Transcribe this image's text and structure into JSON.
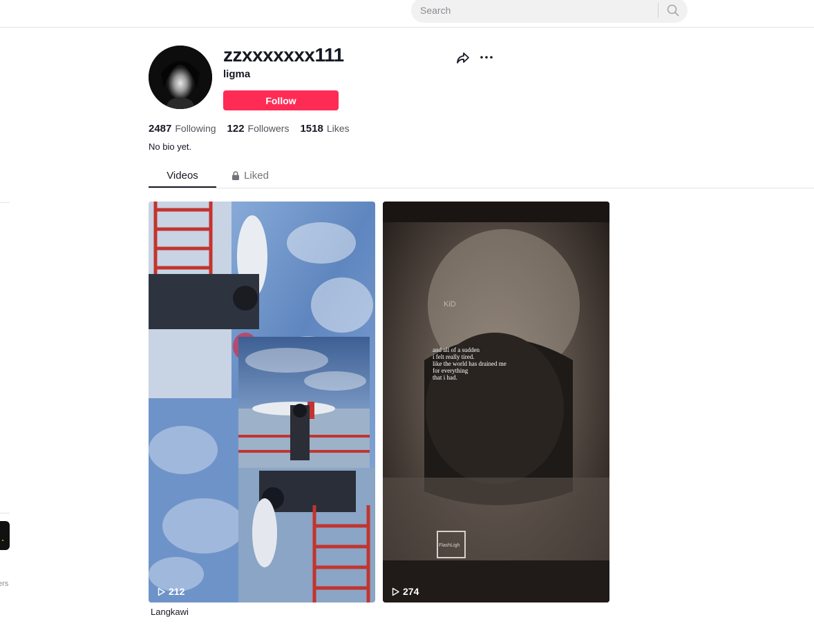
{
  "search": {
    "placeholder": "Search"
  },
  "profile": {
    "username": "zzxxxxxxx111",
    "nickname": "ligma",
    "follow_label": "Follow",
    "bio": "No bio yet."
  },
  "stats": [
    {
      "value": "2487",
      "label": "Following"
    },
    {
      "value": "122",
      "label": "Followers"
    },
    {
      "value": "1518",
      "label": "Likes"
    }
  ],
  "tabs": {
    "videos": "Videos",
    "liked": "Liked"
  },
  "videos": [
    {
      "views": "212",
      "caption": "Langkawi"
    },
    {
      "views": "274",
      "caption": "",
      "overlay_text": [
        "and all of a sudden",
        "i felt really tired.",
        "like the world has drained me",
        "for everything",
        "that i had."
      ],
      "kid_text": "KiD",
      "flash_text": "FlashLigh"
    }
  ],
  "leftrail": {
    "partial_text": "ers"
  },
  "colors": {
    "accent": "#fe2c55",
    "text": "#161823",
    "muted": "#54555c"
  }
}
